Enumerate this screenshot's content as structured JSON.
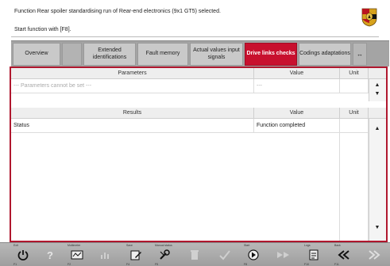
{
  "header": {
    "line1": "Function Rear spoiler standardising run of Rear-end electronics (9x1 GT5) selected.",
    "line2": "Start function with [F8]."
  },
  "tabs": [
    {
      "label": "Overview",
      "active": false
    },
    {
      "label": "",
      "active": false
    },
    {
      "label": "Extended identifications",
      "active": false
    },
    {
      "label": "Fault memory",
      "active": false
    },
    {
      "label": "Actual values input signals",
      "active": false
    },
    {
      "label": "Drive links checks",
      "active": true
    },
    {
      "label": "Codings adaptations",
      "active": false
    },
    {
      "label": "↔",
      "active": false
    }
  ],
  "parameters": {
    "headers": [
      "Parameters",
      "Value",
      "Unit"
    ],
    "rows": [
      {
        "name": "--- Parameters cannot be set ---",
        "value": "---",
        "unit": ""
      }
    ]
  },
  "results": {
    "headers": [
      "Results",
      "Value",
      "Unit"
    ],
    "rows": [
      {
        "name": "Status",
        "value": "Function completed",
        "unit": ""
      }
    ]
  },
  "fkeys": [
    {
      "label": "Exit",
      "num": "F1",
      "icon": "power-icon"
    },
    {
      "label": "",
      "num": "",
      "icon": "help-icon"
    },
    {
      "label": "Multimeter",
      "num": "F2",
      "icon": "multimeter-icon"
    },
    {
      "label": "",
      "num": "",
      "icon": "chart-icon"
    },
    {
      "label": "Save",
      "num": "F4",
      "icon": "save-icon"
    },
    {
      "label": "Manual status",
      "num": "F5",
      "icon": "wrench-icon"
    },
    {
      "label": "",
      "num": "",
      "icon": "delete-icon"
    },
    {
      "label": "",
      "num": "",
      "icon": "tick-icon"
    },
    {
      "label": "Start",
      "num": "F8",
      "icon": "start-icon"
    },
    {
      "label": "",
      "num": "",
      "icon": "forward-icon"
    },
    {
      "label": "Logs",
      "num": "F10",
      "icon": "doc-icon"
    },
    {
      "label": "Back",
      "num": "F11",
      "icon": "back-icon"
    },
    {
      "label": "",
      "num": "",
      "icon": "next-icon"
    }
  ],
  "colors": {
    "accent": "#c8102e",
    "tabbar": "#a4a4a4",
    "bottombar": "#a8a8a8"
  }
}
